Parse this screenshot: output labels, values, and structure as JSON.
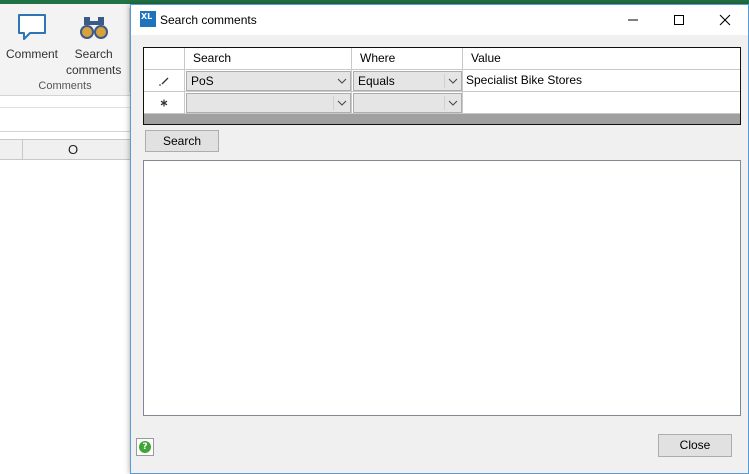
{
  "ribbon": {
    "comment_label": "Comment",
    "search_comments_label_line1": "Search",
    "search_comments_label_line2": "comments",
    "group_label": "Comments"
  },
  "sheet": {
    "column_o": "O"
  },
  "dialog": {
    "app_icon_text": "XL",
    "title": "Search comments",
    "grid": {
      "headers": [
        "Search",
        "Where",
        "Value"
      ],
      "rows": [
        {
          "row_marker": "edit-pencil",
          "search": "PoS",
          "where": "Equals",
          "value": "Specialist Bike Stores"
        },
        {
          "row_marker": "new-row-asterisk",
          "search": "",
          "where": "",
          "value": ""
        }
      ]
    },
    "search_button": "Search",
    "close_button": "Close",
    "help_icon": "?"
  },
  "colors": {
    "accent_green": "#217346",
    "dialog_border": "#5b9bd5",
    "app_icon_blue": "#1e73be"
  }
}
